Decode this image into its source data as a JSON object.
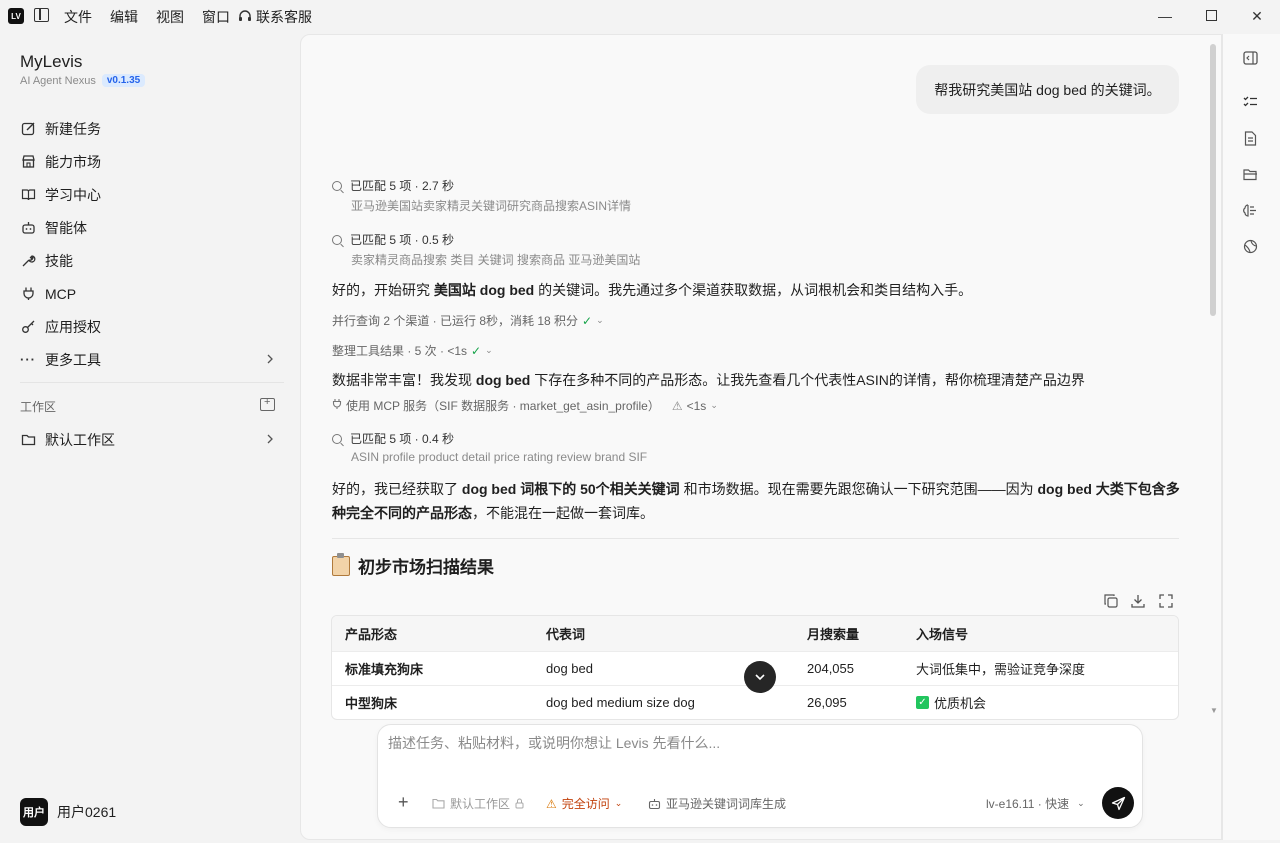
{
  "titlebar": {
    "logo": "LV",
    "menu": [
      "文件",
      "编辑",
      "视图",
      "窗口"
    ],
    "support": "联系客服"
  },
  "sidebar": {
    "brand": "MyLevis",
    "subtitle": "AI Agent Nexus",
    "version": "v0.1.35",
    "items": [
      {
        "label": "新建任务",
        "icon": "edit-icon"
      },
      {
        "label": "能力市场",
        "icon": "store-icon"
      },
      {
        "label": "学习中心",
        "icon": "book-icon"
      },
      {
        "label": "智能体",
        "icon": "robot-icon"
      },
      {
        "label": "技能",
        "icon": "wrench-icon"
      },
      {
        "label": "MCP",
        "icon": "plug-icon"
      },
      {
        "label": "应用授权",
        "icon": "key-icon"
      },
      {
        "label": "更多工具",
        "icon": "more-icon"
      }
    ],
    "workspace_title": "工作区",
    "workspace_item": "默认工作区",
    "user_avatar": "用户",
    "user_name": "用户0261"
  },
  "chat": {
    "user_message": "帮我研究美国站 dog bed 的关键词。",
    "tool1_title": "已匹配 5 项 · 2.7 秒",
    "tool1_sub": "亚马逊美国站卖家精灵关键词研究商品搜索ASIN详情",
    "tool2_title": "已匹配 5 项 · 0.5 秒",
    "tool2_sub": "卖家精灵商品搜索 类目 关键词 搜索商品 亚马逊美国站",
    "para1_a": "好的，开始研究 ",
    "para1_b": "美国站 dog bed",
    "para1_c": " 的关键词。我先通过多个渠道获取数据，从词根机会和类目结构入手。",
    "meta1": "并行查询 2 个渠道 · 已运行 8秒，消耗 18 积分",
    "meta2": "整理工具结果 · 5 次 · <1s",
    "para2_a": "数据非常丰富！我发现 ",
    "para2_b": "dog bed",
    "para2_c": " 下存在多种不同的产品形态。让我先查看几个代表性ASIN的详情，帮你梳理清楚产品边界",
    "meta3": "使用 MCP 服务（SIF 数据服务 · market_get_asin_profile）",
    "meta3_time": "<1s",
    "tool3_title": "已匹配 5 项 · 0.4 秒",
    "tool3_sub": "ASIN profile product detail price rating review brand SIF",
    "para3_a": "好的，我已经获取了 ",
    "para3_b": "dog bed 词根下的 50个相关关键词",
    "para3_c": " 和市场数据。现在需要先跟您确认一下研究范围——因为 ",
    "para3_d": "dog bed 大类下包含多种完全不同的产品形态",
    "para3_e": "，不能混在一起做一套词库。",
    "section_title": "初步市场扫描结果"
  },
  "table": {
    "headers": [
      "产品形态",
      "代表词",
      "月搜索量",
      "入场信号"
    ],
    "rows": [
      {
        "form": "标准填充狗床",
        "keyword": "dog bed",
        "volume": "204,055",
        "signal": "大词低集中，需验证竞争深度",
        "check": false
      },
      {
        "form": "中型狗床",
        "keyword": "dog bed medium size dog",
        "volume": "26,095",
        "signal": "优质机会",
        "check": true
      }
    ]
  },
  "composer": {
    "placeholder": "描述任务、粘贴材料，或说明你想让 Levis 先看什么...",
    "workspace": "默认工作区",
    "access": "完全访问",
    "agent": "亚马逊关键词词库生成",
    "model": "lv-e16.11 · 快速"
  },
  "colors": {
    "accent": "#111111",
    "success": "#16a34a",
    "warning": "#d97706",
    "version_bg": "#dbeafe"
  }
}
